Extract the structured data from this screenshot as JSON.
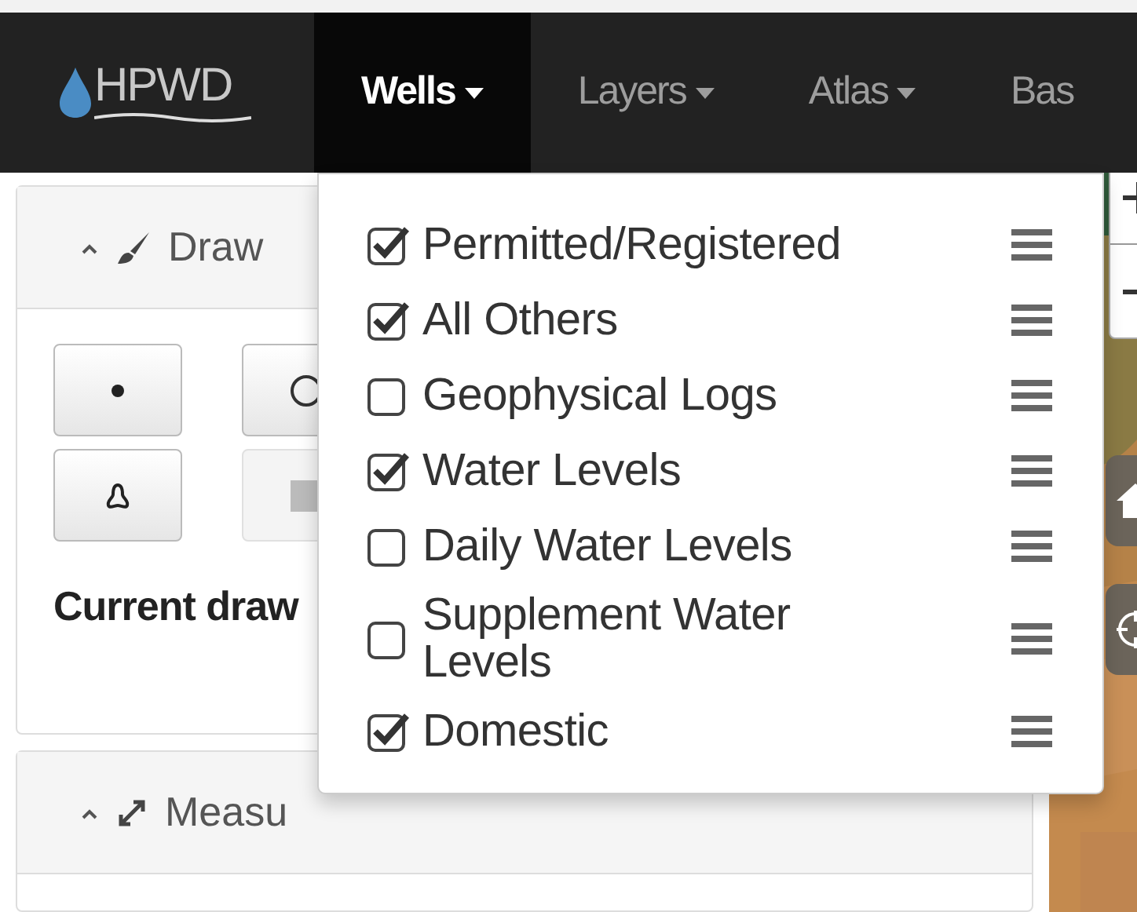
{
  "logo": {
    "text": "HPWD"
  },
  "nav": [
    {
      "label": "Wells",
      "selected": true
    },
    {
      "label": "Layers",
      "selected": false
    },
    {
      "label": "Atlas",
      "selected": false
    },
    {
      "label": "Bas",
      "selected": false
    }
  ],
  "draw_panel": {
    "title": "Draw",
    "expanded": true,
    "tools": [
      {
        "kind": "point",
        "disabled": false
      },
      {
        "kind": "circle",
        "disabled": false
      },
      {
        "kind": "polygon",
        "disabled": false
      },
      {
        "kind": "rectangle",
        "disabled": true
      }
    ],
    "current_label": "Current draw"
  },
  "measure_panel": {
    "title": "Measu",
    "expanded": true
  },
  "wells_menu": {
    "items": [
      {
        "label": "Permitted/Registered",
        "checked": true
      },
      {
        "label": "All Others",
        "checked": true
      },
      {
        "label": "Geophysical Logs",
        "checked": false
      },
      {
        "label": "Water Levels",
        "checked": true
      },
      {
        "label": "Daily Water Levels",
        "checked": false
      },
      {
        "label": "Supplement Water Levels",
        "checked": false
      },
      {
        "label": "Domestic",
        "checked": true
      }
    ]
  }
}
